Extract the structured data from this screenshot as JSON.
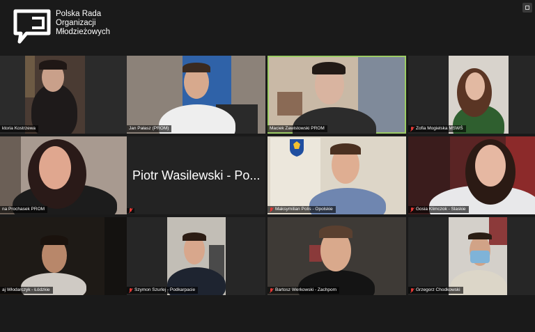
{
  "org": {
    "line1": "Polska Rada",
    "line2": "Organizacji",
    "line3": "Młodzieżowych"
  },
  "participants": [
    {
      "name": "ktoria Kostrzewa",
      "muted": false,
      "active": false
    },
    {
      "name": "Jan Pałasz (PROM)",
      "muted": false,
      "active": false
    },
    {
      "name": "Maciek Zawistowski PROM",
      "muted": false,
      "active": true
    },
    {
      "name": "Zofia Mogielska MSWŚ",
      "muted": true,
      "active": false
    },
    {
      "name": "na Prochasek PROM",
      "muted": false,
      "active": false
    },
    {
      "name": "",
      "display_name": "Piotr Wasilewski - Po...",
      "muted": true,
      "active": false
    },
    {
      "name": "Maksymilian Polis - Opolskie",
      "muted": true,
      "active": false
    },
    {
      "name": "Gosia Klimczok - Slaskie",
      "muted": true,
      "active": false
    },
    {
      "name": "aj Włodarczyk - Łódzkie",
      "muted": false,
      "active": false
    },
    {
      "name": "Szymon Szurlej - Podkarpacie",
      "muted": true,
      "active": false
    },
    {
      "name": "Bartosz Werkowski - Zachpom",
      "muted": true,
      "active": false
    },
    {
      "name": "Grzegorz Chodkowski",
      "muted": true,
      "active": false
    }
  ],
  "colors": {
    "background": "#1a1a1a",
    "active_speaker": "#9ccc65",
    "muted_icon": "#e53935"
  }
}
